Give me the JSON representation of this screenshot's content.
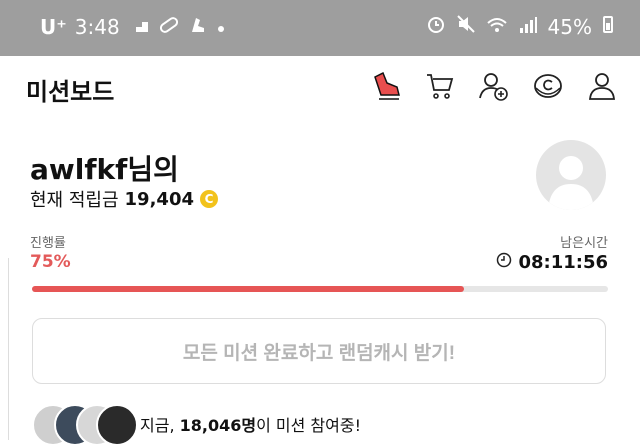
{
  "statusbar": {
    "carrier": "U⁺",
    "time": "3:48",
    "battery": "45%"
  },
  "header": {
    "title": "미션보드"
  },
  "user": {
    "greeting": "awlfkf님의",
    "points_label": "현재 적립금",
    "points_value": "19,404",
    "coin_symbol": "C"
  },
  "progress": {
    "label": "진행률",
    "percent_text": "75%",
    "fraction": 0.75
  },
  "timer": {
    "label": "남은시간",
    "value": "08:11:56"
  },
  "claim": {
    "label": "모든 미션 완료하고 랜덤캐시 받기!"
  },
  "participants": {
    "prefix": "지금, ",
    "count": "18,046명",
    "suffix": "이 미션 참여중!"
  },
  "colors": {
    "accent": "#e65555",
    "coin": "#f2c21b",
    "statusbar": "#9e9e9e"
  },
  "icons": [
    "shoe-icon",
    "cart-icon",
    "add-friend-icon",
    "coin-c-icon",
    "user-icon"
  ]
}
